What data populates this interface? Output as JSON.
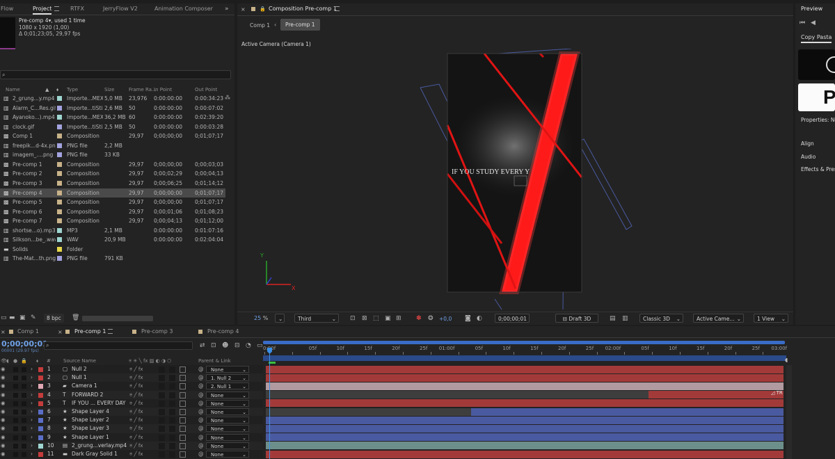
{
  "project_tabs": [
    "Flow",
    "Project",
    "RTFX",
    "JerryFlow V2",
    "Animation Composer"
  ],
  "project_info": {
    "name": "Pre-comp 4",
    "used": ", used 1 time",
    "size": "1080 x 1920 (1,00)",
    "duration": "Δ 0;01;23;05, 29,97 fps"
  },
  "project_search_placeholder": "",
  "project_columns": [
    "Name",
    "Type",
    "Size",
    "Frame Ra...",
    "In Point",
    "Out Point"
  ],
  "project_items": [
    {
      "name": "2_grung...y.mp4",
      "type": "Importe...MEX",
      "size": "5,0 MB",
      "fps": "23,976",
      "in": "0:00:00:00",
      "out": "0:00:34:23",
      "color": "#9fd6d1",
      "icon": "file"
    },
    {
      "name": "Alarm_C...Res.gif",
      "type": "Importe...tiStill",
      "size": "2,6 MB",
      "fps": "50",
      "in": "0:00:00:00",
      "out": "0:00:07:02",
      "color": "#a3a3e0",
      "icon": "file"
    },
    {
      "name": "Ayanoko...).mp4",
      "type": "Importe...MEX",
      "size": "36,2 MB",
      "fps": "60",
      "in": "0:00:00:00",
      "out": "0:02:39:20",
      "color": "#9fd6d1",
      "icon": "file"
    },
    {
      "name": "clock.gif",
      "type": "Importe...tiStill",
      "size": "2,5 MB",
      "fps": "50",
      "in": "0:00:00:00",
      "out": "0:00:03:28",
      "color": "#a3a3e0",
      "icon": "file"
    },
    {
      "name": "Comp 1",
      "type": "Composition",
      "size": "",
      "fps": "29,97",
      "in": "0;00;00;00",
      "out": "0;01;07;17",
      "color": "#c8b289",
      "icon": "comp"
    },
    {
      "name": "freepik...d-4x.png",
      "type": "PNG file",
      "size": "2,2 MB",
      "fps": "",
      "in": "",
      "out": "",
      "color": "#a3a3e0",
      "icon": "file"
    },
    {
      "name": "imagem_....png",
      "type": "PNG file",
      "size": "33 KB",
      "fps": "",
      "in": "",
      "out": "",
      "color": "#a3a3e0",
      "icon": "file"
    },
    {
      "name": "Pre-comp 1",
      "type": "Composition",
      "size": "",
      "fps": "29,97",
      "in": "0;00;00;00",
      "out": "0;00;03;03",
      "color": "#c8b289",
      "icon": "comp"
    },
    {
      "name": "Pre-comp 2",
      "type": "Composition",
      "size": "",
      "fps": "29,97",
      "in": "0;00;02;29",
      "out": "0;00;04;13",
      "color": "#c8b289",
      "icon": "comp"
    },
    {
      "name": "Pre-comp 3",
      "type": "Composition",
      "size": "",
      "fps": "29,97",
      "in": "0;00;06;25",
      "out": "0;01;14;12",
      "color": "#c8b289",
      "icon": "comp"
    },
    {
      "name": "Pre-comp 4",
      "type": "Composition",
      "size": "",
      "fps": "29,97",
      "in": "0;00;00;00",
      "out": "0;01;07;17",
      "color": "#c8b289",
      "icon": "comp",
      "selected": true
    },
    {
      "name": "Pre-comp 5",
      "type": "Composition",
      "size": "",
      "fps": "29,97",
      "in": "0;00;00;00",
      "out": "0;01;07;17",
      "color": "#c8b289",
      "icon": "comp"
    },
    {
      "name": "Pre-comp 6",
      "type": "Composition",
      "size": "",
      "fps": "29,97",
      "in": "0;00;01;06",
      "out": "0;01;08;23",
      "color": "#c8b289",
      "icon": "comp"
    },
    {
      "name": "Pre-comp 7",
      "type": "Composition",
      "size": "",
      "fps": "29,97",
      "in": "0;00;04;13",
      "out": "0;01;12;00",
      "color": "#c8b289",
      "icon": "comp"
    },
    {
      "name": "shortse...o).mp3",
      "type": "MP3",
      "size": "2,1 MB",
      "fps": "",
      "in": "0:00:00:00",
      "out": "0:01:07:16",
      "color": "#9fd6d1",
      "icon": "file"
    },
    {
      "name": "Silkson...be_.wav",
      "type": "WAV",
      "size": "20,9 MB",
      "fps": "",
      "in": "0:00:00:00",
      "out": "0:02:04:04",
      "color": "#9fd6d1",
      "icon": "file"
    },
    {
      "name": "Solids",
      "type": "Folder",
      "size": "",
      "fps": "",
      "in": "",
      "out": "",
      "color": "#e6d84a",
      "icon": "folder"
    },
    {
      "name": "The-Mat...th.png",
      "type": "PNG file",
      "size": "791 KB",
      "fps": "",
      "in": "",
      "out": "",
      "color": "#a3a3e0",
      "icon": "file"
    }
  ],
  "project_footer": {
    "bpc": "8 bpc"
  },
  "comp_panel": {
    "title": "Composition Pre-comp 1",
    "nav": [
      "Comp 1",
      "Pre-comp 1"
    ],
    "camera_label": "Active Camera (Camera 1)",
    "overlay_text": "IF YOU STUDY EVERY    Y"
  },
  "viewer_bar": {
    "zoom": "25",
    "zoom_unit": "%",
    "resolution": "Third",
    "exposure": "+0,0",
    "timecode": "0;00;00;01",
    "draft": "Draft 3D",
    "renderer": "Classic 3D",
    "camera": "Active Came...",
    "views": "1 View"
  },
  "right_panel": {
    "preview": "Preview",
    "copy_paste": "Copy Pasta",
    "properties": "Properties: No",
    "align": "Align",
    "audio": "Audio",
    "effects": "Effects & Prese"
  },
  "timeline_tabs": [
    "Comp 1",
    "Pre-comp 1",
    "Pre-comp 3",
    "Pre-comp 4"
  ],
  "timeline": {
    "timecode": "0;00;00;01",
    "fps_info": "00001 (29.97 fps)",
    "col_source": "Source Name",
    "col_parent": "Parent & Link"
  },
  "ruler_labels": [
    "0:00f",
    "05f",
    "10f",
    "15f",
    "20f",
    "25f",
    "01:00f",
    "05f",
    "10f",
    "15f",
    "20f",
    "25f",
    "02:00f",
    "05f",
    "10f",
    "15f",
    "20f",
    "25f",
    "03:00f"
  ],
  "layers": [
    {
      "num": "1",
      "name": "Null 2",
      "label": "#c43c3c",
      "icon": "null",
      "parent": "None",
      "bar": "#a33a3a"
    },
    {
      "num": "2",
      "name": "Null 1",
      "label": "#c43c3c",
      "icon": "null",
      "parent": "1. Null 2",
      "bar": "#a33a3a"
    },
    {
      "num": "3",
      "name": "Camera 1",
      "label": "#e0a8b4",
      "icon": "camera",
      "parent": "2. Null 1",
      "bar": "#b19aa0"
    },
    {
      "num": "4",
      "name": "FORWARD 2",
      "label": "#c43c3c",
      "icon": "text",
      "parent": "None",
      "bar": "#a33a3a",
      "bar_start": 0.74
    },
    {
      "num": "5",
      "name": "IF YOU ... EVERY DAY",
      "label": "#c43c3c",
      "icon": "text",
      "parent": "None",
      "bar": "#a33a3a"
    },
    {
      "num": "6",
      "name": "Shape Layer 4",
      "label": "#5a6ec8",
      "icon": "shape",
      "parent": "None",
      "bar": "#4a5aa0",
      "bar_start": 0.4
    },
    {
      "num": "7",
      "name": "Shape Layer 2",
      "label": "#5a6ec8",
      "icon": "shape",
      "parent": "None",
      "bar": "#4a5aa0"
    },
    {
      "num": "8",
      "name": "Shape Layer 3",
      "label": "#5a6ec8",
      "icon": "shape",
      "parent": "None",
      "bar": "#4a5aa0"
    },
    {
      "num": "9",
      "name": "Shape Layer 1",
      "label": "#5a6ec8",
      "icon": "shape",
      "parent": "None",
      "bar": "#4a5aa0"
    },
    {
      "num": "10",
      "name": "2_grung...verlay.mp4",
      "label": "#9fd6d1",
      "icon": "footage",
      "parent": "None",
      "bar": "#6d8f8c"
    },
    {
      "num": "11",
      "name": "Dark Gray Solid 1",
      "label": "#c43c3c",
      "icon": "solid",
      "parent": "None",
      "bar": "#a33a3a"
    }
  ]
}
